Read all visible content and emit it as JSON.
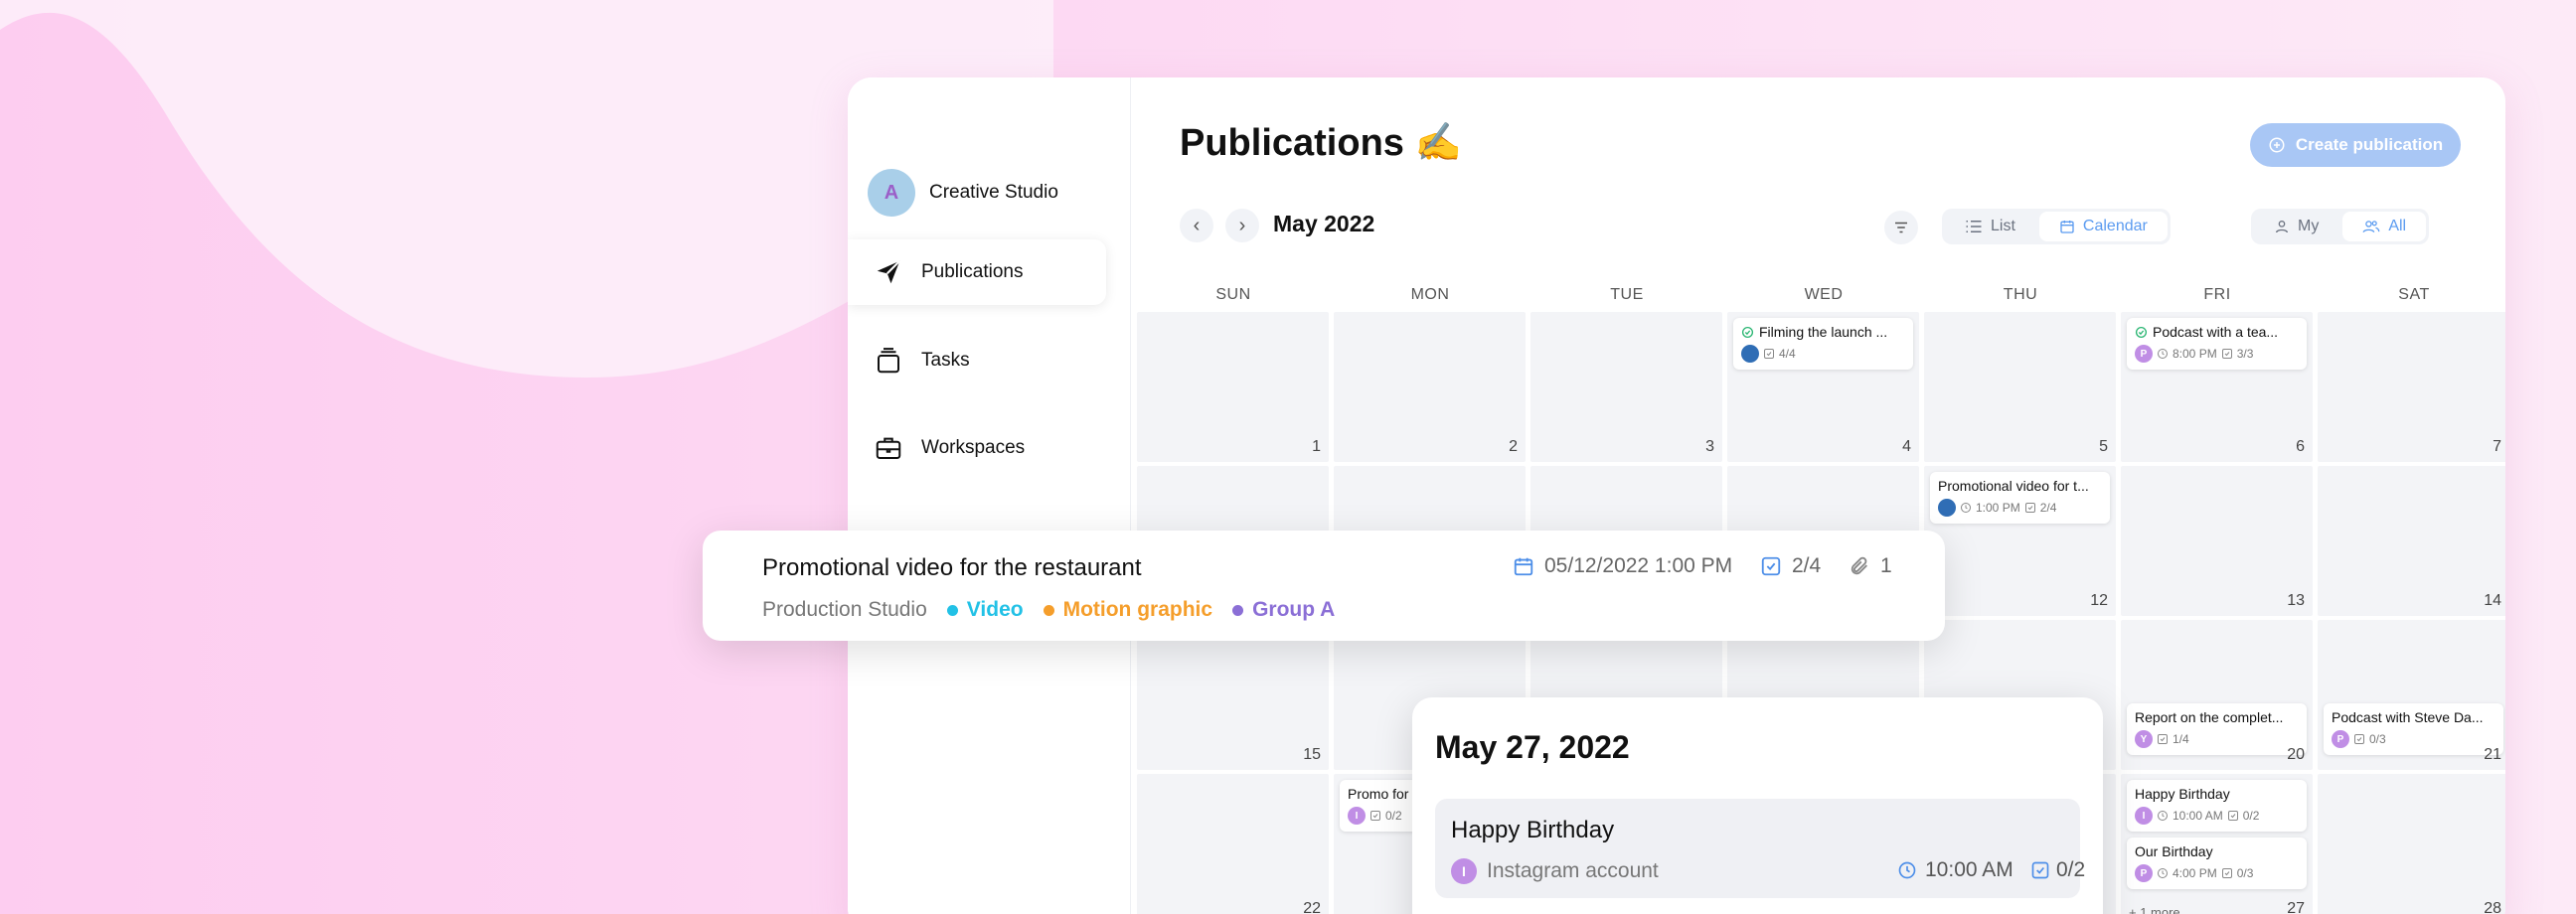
{
  "workspace": {
    "initial": "A",
    "name": "Creative Studio"
  },
  "sidebar": {
    "items": [
      {
        "label": "Publications",
        "icon": "paper-plane-icon",
        "active": true
      },
      {
        "label": "Tasks",
        "icon": "stack-icon",
        "active": false
      },
      {
        "label": "Workspaces",
        "icon": "briefcase-icon",
        "active": false
      }
    ]
  },
  "header": {
    "title": "Publications ✍️",
    "create_label": "Create publication",
    "month": "May 2022",
    "view_list": "List",
    "view_calendar": "Calendar",
    "scope_my": "My",
    "scope_all": "All"
  },
  "colors": {
    "accent": "#5b9bf0",
    "create_bg": "#a9c7f5",
    "video": "#22c1e6",
    "motion": "#f59e2b",
    "group": "#8b6fd6"
  },
  "weekdays": [
    "SUN",
    "MON",
    "TUE",
    "WED",
    "THU",
    "FRI",
    "SAT"
  ],
  "weeks": [
    [
      "1",
      "2",
      "3",
      "4",
      "5",
      "6",
      "7"
    ],
    [
      "",
      "",
      "",
      "",
      "12",
      "13",
      "14"
    ],
    [
      "15",
      "",
      "",
      "",
      "",
      "20",
      "21"
    ],
    [
      "22",
      "",
      "",
      "",
      "",
      "27",
      "28"
    ]
  ],
  "events": {
    "wed4": {
      "title": "Filming the launch ...",
      "tasks": "4/4"
    },
    "fri6": {
      "title": "Podcast with a tea...",
      "avatar": "P",
      "time": "8:00 PM",
      "tasks": "3/3"
    },
    "thu12": {
      "title": "Promotional video for t...",
      "time": "1:00 PM",
      "tasks": "2/4"
    },
    "fri20": {
      "title": "Report on the complet...",
      "avatar": "Y",
      "tasks": "1/4"
    },
    "sat21": {
      "title": "Podcast with Steve Da...",
      "avatar": "P",
      "tasks": "0/3"
    },
    "mon23": {
      "title": "Promo for",
      "avatar": "I",
      "tasks": "0/2"
    },
    "fri27a": {
      "title": "Happy Birthday",
      "avatar": "I",
      "time": "10:00 AM",
      "tasks": "0/2"
    },
    "fri27b": {
      "title": "Our Birthday",
      "avatar": "P",
      "time": "4:00 PM",
      "tasks": "0/3"
    },
    "fri27_more": "+ 1 more"
  },
  "popover_pub": {
    "title": "Promotional video for the restaurant",
    "date": "05/12/2022 1:00 PM",
    "tasks": "2/4",
    "attachments": "1",
    "studio": "Production Studio",
    "tags": [
      "Video",
      "Motion graphic",
      "Group A"
    ]
  },
  "popover_day": {
    "date": "May 27, 2022",
    "event_title": "Happy Birthday",
    "avatar": "I",
    "account": "Instagram account",
    "time": "10:00 AM",
    "tasks": "0/2"
  }
}
